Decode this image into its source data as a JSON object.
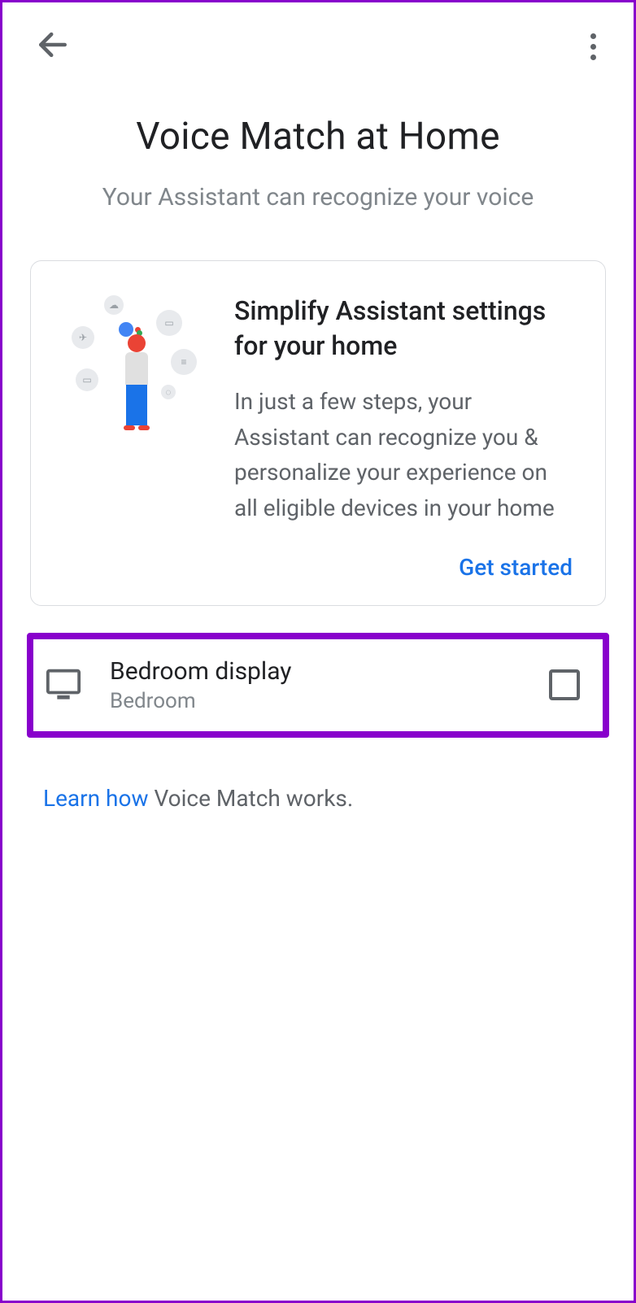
{
  "header": {
    "title": "Voice Match at Home",
    "subtitle": "Your Assistant can recognize your voice"
  },
  "card": {
    "title": "Simplify Assistant settings for your home",
    "description": "In just a few steps, your Assistant can recognize you & personalize your experience on all eligible devices in your home",
    "action": "Get started"
  },
  "device": {
    "name": "Bedroom display",
    "room": "Bedroom",
    "checked": false
  },
  "learn": {
    "link": "Learn how",
    "rest": " Voice Match works."
  },
  "colors": {
    "accent": "#1a73e8",
    "highlight": "#8800cc",
    "text_secondary": "#5f6368"
  }
}
